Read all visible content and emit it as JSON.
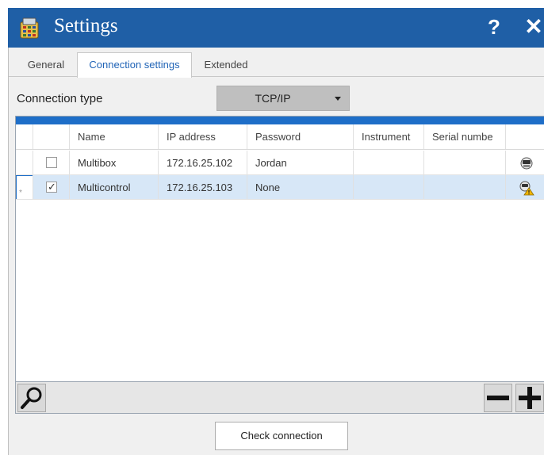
{
  "window": {
    "title": "Settings",
    "app_icon": "calculator-app-icon",
    "help_label": "?",
    "close_label": "✕",
    "accent_color": "#1f5fa6"
  },
  "tabs": [
    {
      "label": "General",
      "active": false
    },
    {
      "label": "Connection settings",
      "active": true
    },
    {
      "label": "Extended",
      "active": false
    }
  ],
  "connection": {
    "label": "Connection type",
    "selected": "TCP/IP"
  },
  "table": {
    "headers": [
      "Name",
      "IP address",
      "Password",
      "Instrument",
      "Serial numbe"
    ],
    "rows": [
      {
        "checked": false,
        "name": "Multibox",
        "ip": "172.16.25.102",
        "password": "Jordan",
        "instrument": "",
        "serial": "",
        "status_icon": "device-icon",
        "selected": false
      },
      {
        "checked": true,
        "name": "Multicontrol",
        "ip": "172.16.25.103",
        "password": "None",
        "instrument": "",
        "serial": "",
        "status_icon": "device-warning-icon",
        "selected": true
      }
    ],
    "selected_row_color": "#d7e7f7"
  },
  "toolbar": {
    "search_icon": "search-icon",
    "remove_icon": "minus-icon",
    "add_icon": "plus-icon"
  },
  "footer": {
    "check_connection_label": "Check connection"
  }
}
